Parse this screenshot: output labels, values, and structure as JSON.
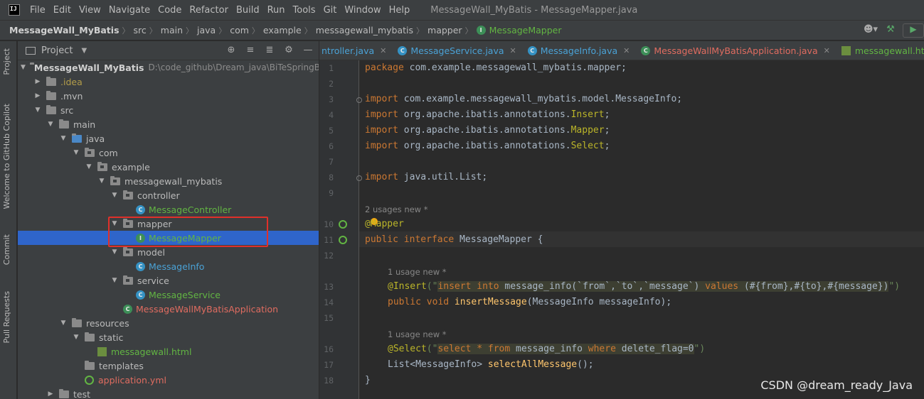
{
  "menu": {
    "logo": "IJ",
    "items": [
      "File",
      "Edit",
      "View",
      "Navigate",
      "Code",
      "Refactor",
      "Build",
      "Run",
      "Tools",
      "Git",
      "Window",
      "Help"
    ],
    "window_title": "MessageWall_MyBatis - MessageMapper.java"
  },
  "breadcrumb": {
    "items": [
      "MessageWall_MyBatis",
      "src",
      "main",
      "java",
      "com",
      "example",
      "messagewall_mybatis",
      "mapper"
    ],
    "current": "MessageMapper"
  },
  "sidebar": {
    "project_tab": "Project",
    "copilot_tab": "Welcome to GitHub Copilot",
    "commit_tab": "Commit",
    "pull_requests_tab": "Pull Requests"
  },
  "project_panel": {
    "title": "Project",
    "root_name": "MessageWall_MyBatis",
    "root_path": "D:\\code_github\\Dream_java\\BiTeSpringBo",
    "nodes": {
      "idea": ".idea",
      "mvn": ".mvn",
      "src": "src",
      "main": "main",
      "java": "java",
      "com": "com",
      "example": "example",
      "pkg": "messagewall_mybatis",
      "controller": "controller",
      "message_controller": "MessageController",
      "mapper": "mapper",
      "message_mapper": "MessageMapper",
      "model": "model",
      "message_info": "MessageInfo",
      "service": "service",
      "message_service": "MessageService",
      "app": "MessageWallMyBatisApplication",
      "resources": "resources",
      "static": "static",
      "messagewall_html": "messagewall.html",
      "templates": "templates",
      "application_yml": "application.yml",
      "test": "test"
    }
  },
  "tabs": [
    {
      "label": "ntroller.java",
      "color": "blue",
      "icon": "class"
    },
    {
      "label": "MessageService.java",
      "color": "blue",
      "icon": "class"
    },
    {
      "label": "MessageInfo.java",
      "color": "blue",
      "icon": "class"
    },
    {
      "label": "MessageWallMyBatisApplication.java",
      "color": "red",
      "icon": "spring-class"
    },
    {
      "label": "messagewall.html",
      "color": "green",
      "icon": "html"
    }
  ],
  "editor": {
    "line_numbers": [
      "1",
      "2",
      "3",
      "4",
      "5",
      "6",
      "7",
      "8",
      "9",
      "10",
      "11",
      "12",
      "13",
      "14",
      "15",
      "16",
      "17",
      "18"
    ],
    "hints": {
      "iface": "2 usages   new *",
      "insert": "1 usage   new *",
      "select": "1 usage   new *"
    },
    "code": {
      "l1_kw": "package",
      "l1_rest": " com.example.messagewall_mybatis.mapper;",
      "l3_kw": "import",
      "l3_rest": " com.example.messagewall_mybatis.model.MessageInfo;",
      "l4_kw": "import",
      "l4_pre": " org.apache.ibatis.annotations.",
      "l4_ann": "Insert",
      "l4_end": ";",
      "l5_kw": "import",
      "l5_pre": " org.apache.ibatis.annotations.",
      "l5_ann": "Mapper",
      "l5_end": ";",
      "l6_kw": "import",
      "l6_pre": " org.apache.ibatis.annotations.",
      "l6_ann": "Select",
      "l6_end": ";",
      "l8_kw": "import",
      "l8_rest": " java.util.List;",
      "l10": "@Mapper",
      "l11_kw": "public interface",
      "l11_rest": " MessageMapper {",
      "l13_ann": "@Insert",
      "l13_open": "(\"",
      "l13_sql_kw1": "insert into",
      "l13_sql_mid": " message_info(`from`,`to`,`message`) ",
      "l13_sql_kw2": "values",
      "l13_sql_end": " (#{from},#{to},#{message})",
      "l13_close": "\")",
      "l14_kw": "public void",
      "l14_fn": " insertMessage",
      "l14_rest": "(MessageInfo messageInfo);",
      "l16_ann": "@Select",
      "l16_open": "(\"",
      "l16_sql_kw1": "select * from",
      "l16_sql_mid": " message_info ",
      "l16_sql_kw2": "where",
      "l16_sql_end": " delete_flag=0",
      "l16_close": "\")",
      "l17_pre": "List<MessageInfo>",
      "l17_fn": " selectAllMessage",
      "l17_rest": "();",
      "l18": "}"
    }
  },
  "watermark": "CSDN @dream_ready_Java"
}
